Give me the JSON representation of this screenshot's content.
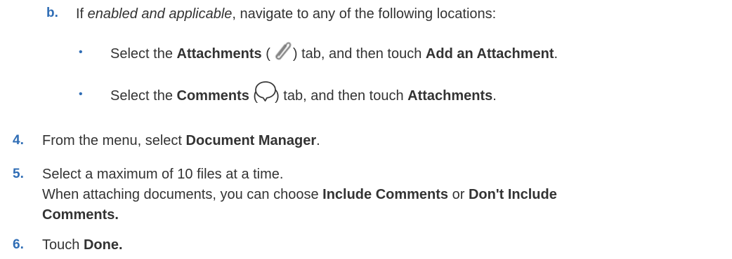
{
  "substep_b": {
    "label": "b.",
    "text_before": "If ",
    "text_italic": "enabled and applicable",
    "text_after": ", navigate to any of the following locations:"
  },
  "bullets": [
    {
      "marker": "•",
      "pre": "Select the ",
      "bold1": "Attachments",
      "open_paren": " (",
      "icon": "paperclip-icon",
      "close_paren": ") tab, and then touch ",
      "bold2": "Add an Attachment",
      "end": "."
    },
    {
      "marker": "•",
      "pre": "Select the ",
      "bold1": "Comments",
      "open_paren": " (",
      "icon": "speech-bubble-icon",
      "close_paren": ") tab, and then touch ",
      "bold2": "Attachments",
      "end": "."
    }
  ],
  "step4": {
    "label": "4.",
    "pre": "From the menu, select ",
    "bold": "Document Manager",
    "end": "."
  },
  "step5": {
    "label": "5.",
    "line1": "Select a maximum of 10 files at a time.",
    "line2_pre": "When attaching documents, you can choose ",
    "line2_bold1": "Include Comments",
    "line2_mid": " or ",
    "line2_bold2": "Don't Include",
    "line3_bold": "Comments."
  },
  "step6": {
    "label": "6.",
    "pre": "Touch ",
    "bold": "Done."
  },
  "colors": {
    "step_label": "#2f6db5",
    "text": "#333333"
  }
}
